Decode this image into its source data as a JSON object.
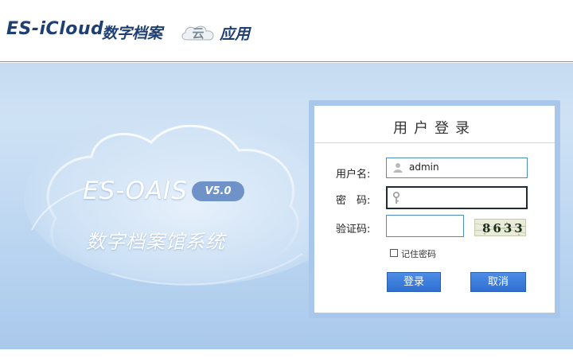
{
  "header": {
    "brand_en": "ES-iCloud",
    "brand_cn": "数字档案",
    "cloud_badge": "云",
    "brand_app": "应用"
  },
  "hero": {
    "product_name": "ES-OAIS",
    "version": "V5.0",
    "product_cn": "数字档案馆系统"
  },
  "login": {
    "title": "用户登录",
    "username_label": "用户名:",
    "username_value": "admin",
    "password_label": "密　码:",
    "password_value": "",
    "captcha_label": "验证码:",
    "captcha_value": "",
    "captcha_image_text": "8633",
    "remember_label": "记住密码",
    "remember_checked": false,
    "login_button": "登录",
    "cancel_button": "取消"
  },
  "colors": {
    "brand_blue": "#1f3f73",
    "button_blue": "#3a7bdc",
    "hero_bg": "#c6dbf1",
    "panel_border": "#a8c7ea"
  },
  "icons": {
    "username": "user-icon",
    "password": "key-icon"
  }
}
